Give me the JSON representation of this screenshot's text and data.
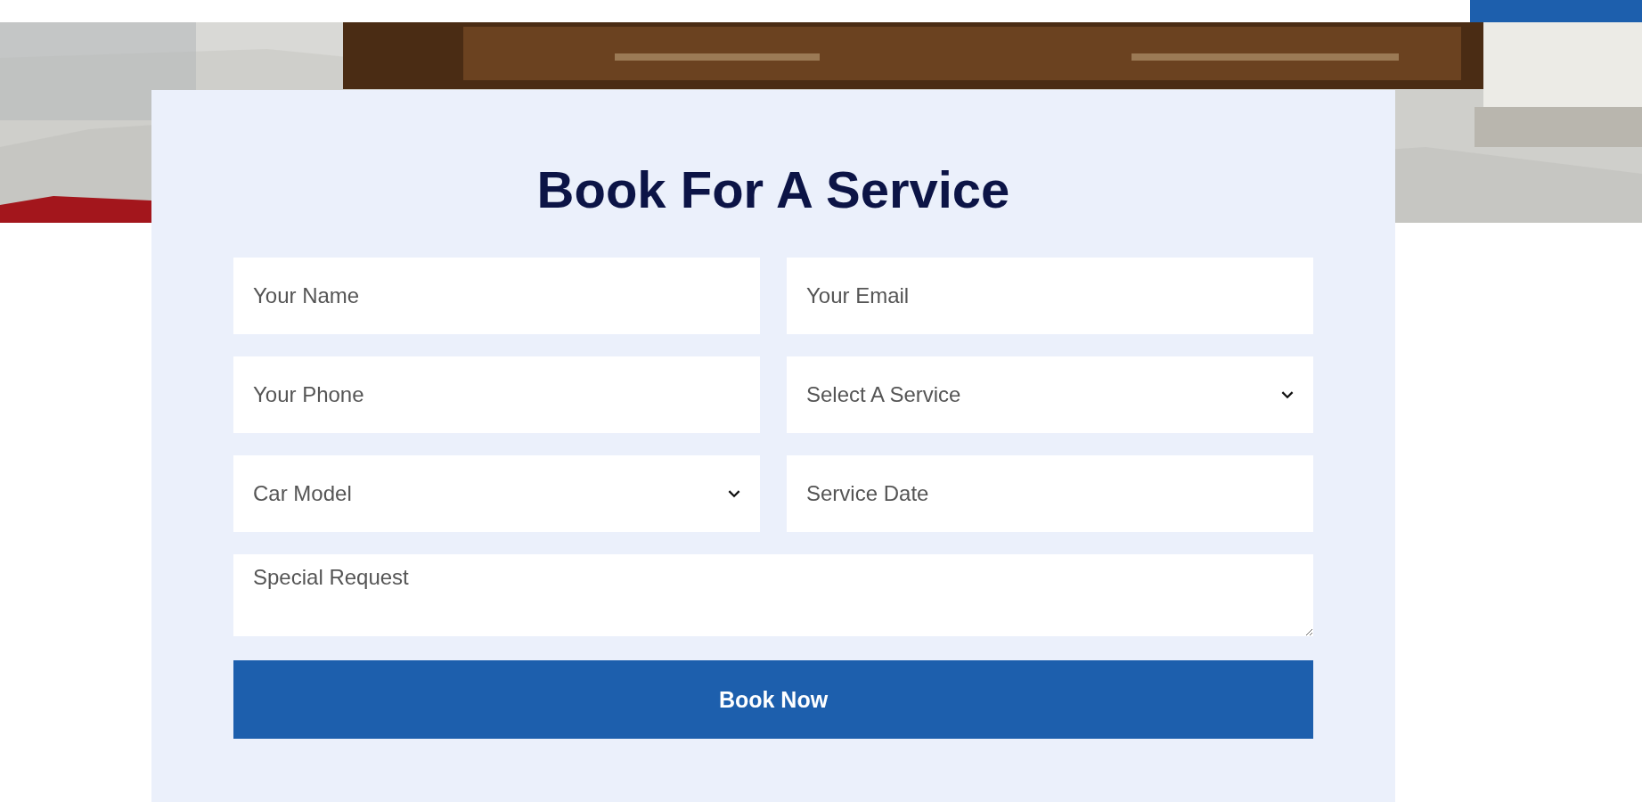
{
  "form": {
    "title": "Book For A Service",
    "fields": [
      {
        "kind": "text",
        "placeholder": "Your Name"
      },
      {
        "kind": "text",
        "placeholder": "Your Email"
      },
      {
        "kind": "text",
        "placeholder": "Your Phone"
      },
      {
        "kind": "select",
        "value": "Select A Service"
      },
      {
        "kind": "select",
        "value": "Car Model"
      },
      {
        "kind": "text",
        "placeholder": "Service Date"
      },
      {
        "kind": "textarea",
        "placeholder": "Special Request"
      }
    ],
    "submit": "Book Now"
  }
}
